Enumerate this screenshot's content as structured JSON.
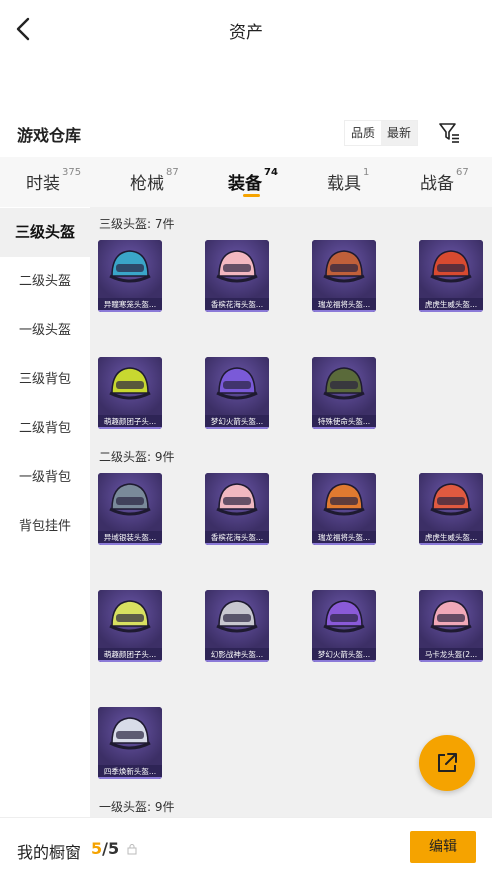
{
  "header": {
    "title": "资产"
  },
  "warehouse": {
    "title": "游戏仓库",
    "sort_options": [
      "品质",
      "最新"
    ],
    "selected_sort": "品质"
  },
  "tabs": [
    {
      "label": "时装",
      "count": "375"
    },
    {
      "label": "枪械",
      "count": "87"
    },
    {
      "label": "装备",
      "count": "74",
      "active": true
    },
    {
      "label": "载具",
      "count": "1"
    },
    {
      "label": "战备",
      "count": "67"
    }
  ],
  "sidebar": [
    {
      "label": "三级头盔",
      "active": true
    },
    {
      "label": "二级头盔"
    },
    {
      "label": "一级头盔"
    },
    {
      "label": "三级背包"
    },
    {
      "label": "二级背包"
    },
    {
      "label": "一级背包"
    },
    {
      "label": "背包挂件"
    }
  ],
  "sections": [
    {
      "title": "三级头盔: 7件",
      "items": [
        {
          "name": "异瞳寒笼头盔...",
          "color": "#3aa6c8"
        },
        {
          "name": "香槟花海头盔...",
          "color": "#f3b8c0"
        },
        {
          "name": "瑞龙福将头盔...",
          "color": "#c0603a"
        },
        {
          "name": "虎虎生威头盔...",
          "color": "#d84a30"
        },
        {
          "name": "萌趣颜团子头...",
          "color": "#c8d830"
        },
        {
          "name": "梦幻火箭头盔...",
          "color": "#7a5ad8"
        },
        {
          "name": "特殊使命头盔...",
          "color": "#5a6a3a"
        }
      ]
    },
    {
      "title": "二级头盔: 9件",
      "items": [
        {
          "name": "异域银装头盔...",
          "color": "#7a8a9a"
        },
        {
          "name": "香槟花海头盔...",
          "color": "#f0b8c0"
        },
        {
          "name": "瑞龙福将头盔...",
          "color": "#e07a30"
        },
        {
          "name": "虎虎生威头盔...",
          "color": "#e05a40"
        },
        {
          "name": "萌趣颜团子头...",
          "color": "#d8e060"
        },
        {
          "name": "幻影战神头盔...",
          "color": "#c8c8d0"
        },
        {
          "name": "梦幻火箭头盔...",
          "color": "#8a5ad8"
        },
        {
          "name": "马卡龙头盔(2...",
          "color": "#f0a8b8"
        },
        {
          "name": "四季焕新头盔...",
          "color": "#d8dce8"
        }
      ]
    },
    {
      "title": "一级头盔: 9件",
      "items": []
    }
  ],
  "showcase": {
    "label": "我的橱窗",
    "current": "5",
    "total": "/5",
    "edit_label": "编辑"
  },
  "colors": {
    "accent": "#f5a300",
    "card": "#4a3a78"
  },
  "icons": {
    "back": "chevron-left-icon",
    "filter": "filter-icon",
    "share": "external-link-icon",
    "lock": "lock-icon"
  }
}
